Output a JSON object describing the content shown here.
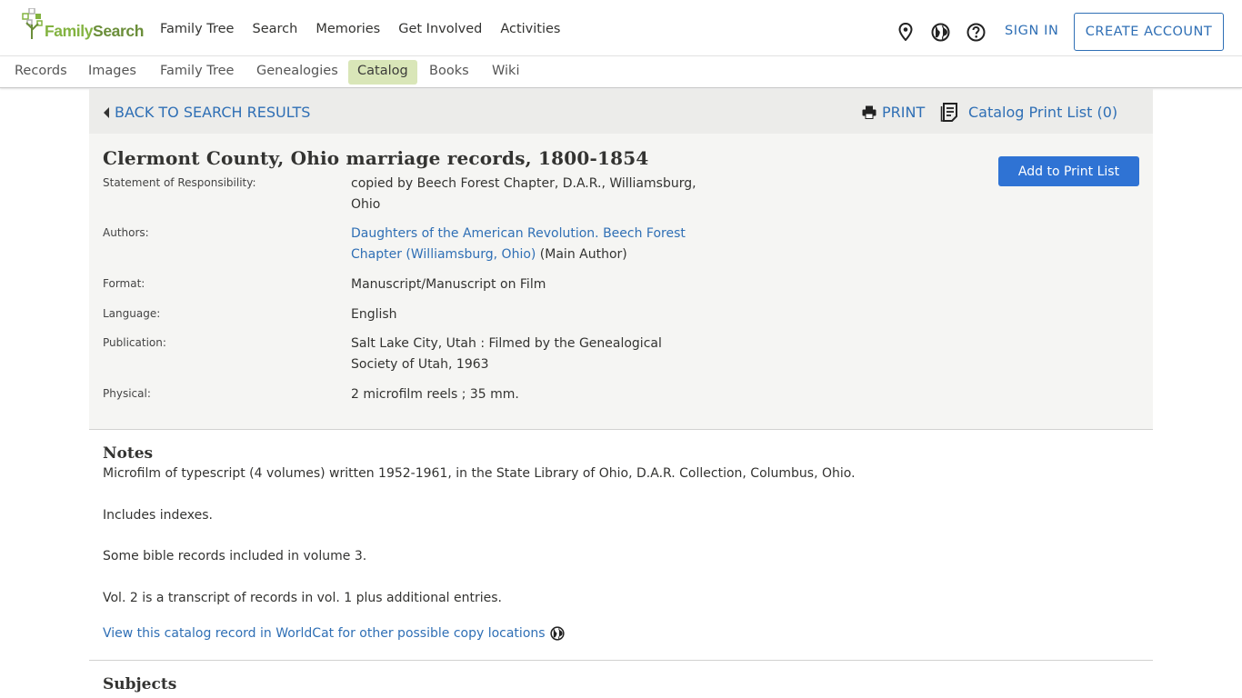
{
  "header": {
    "logo_text_family": "Family",
    "logo_text_search": "Search",
    "nav": [
      "Family Tree",
      "Search",
      "Memories",
      "Get Involved",
      "Activities"
    ],
    "icons": [
      "location-pin-icon",
      "globe-icon",
      "help-icon"
    ],
    "sign_in": "SIGN IN",
    "create_account": "CREATE ACCOUNT"
  },
  "subnav": {
    "items": [
      "Records",
      "Images",
      "Family Tree",
      "Genealogies",
      "Catalog",
      "Books",
      "Wiki"
    ],
    "active": "Catalog"
  },
  "backbar": {
    "back": "BACK TO SEARCH RESULTS",
    "print": "PRINT",
    "print_list": "Catalog Print List (0)"
  },
  "record": {
    "title": "Clermont County, Ohio marriage records, 1800-1854",
    "add_button": "Add to Print List",
    "fields": {
      "responsibility_label": "Statement of Responsibility:",
      "responsibility_value": "copied by Beech Forest Chapter, D.A.R., Williamsburg, Ohio",
      "authors_label": "Authors:",
      "authors_link": "Daughters of the American Revolution. Beech Forest Chapter (Williamsburg, Ohio)",
      "authors_suffix": " (Main Author)",
      "format_label": "Format:",
      "format_value": "Manuscript/Manuscript on Film",
      "language_label": "Language:",
      "language_value": "English",
      "publication_label": "Publication:",
      "publication_value": "Salt Lake City, Utah : Filmed by the Genealogical Society of Utah, 1963",
      "physical_label": "Physical:",
      "physical_value": "2 microfilm reels ; 35 mm."
    }
  },
  "notes": {
    "heading": "Notes",
    "items": [
      "Microfilm of typescript (4 volumes) written 1952-1961, in the State Library of Ohio, D.A.R. Collection, Columbus, Ohio.",
      "Includes indexes.",
      "Some bible records included in volume 3.",
      "Vol. 2 is a transcript of records in vol. 1 plus additional entries."
    ],
    "worldcat": "View this catalog record in WorldCat for other possible copy locations"
  },
  "subjects": {
    "heading": "Subjects"
  },
  "colors": {
    "brand_green": "#83b341",
    "link_blue": "#2f6fb5",
    "button_blue": "#2f73d4",
    "active_tab": "#d9e6b8"
  }
}
